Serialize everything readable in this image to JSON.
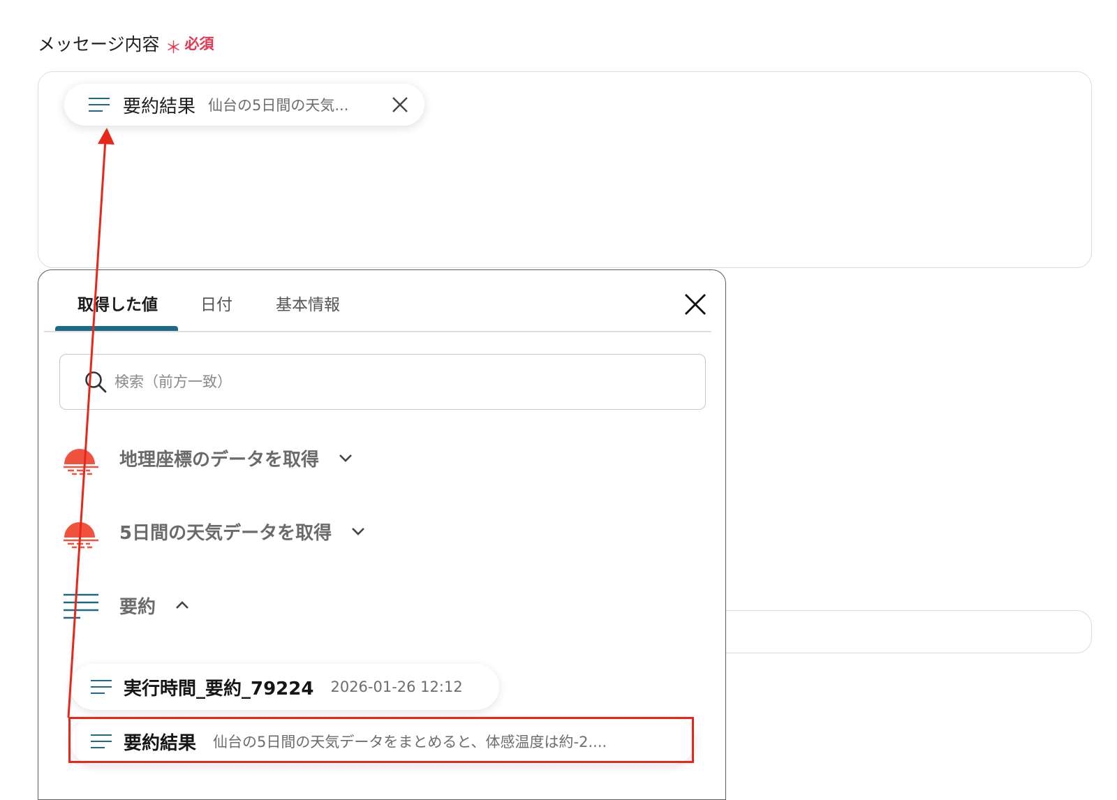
{
  "field": {
    "label": "メッセージ内容",
    "required_mark": "＊",
    "required_text": "必須"
  },
  "chip": {
    "icon": "lines-icon",
    "title": "要約結果",
    "value": "仙台の5日間の天気..."
  },
  "picker": {
    "tabs": [
      {
        "label": "取得した値",
        "active": true
      },
      {
        "label": "日付",
        "active": false
      },
      {
        "label": "基本情報",
        "active": false
      }
    ],
    "search_placeholder": "検索（前方一致）",
    "groups": [
      {
        "icon": "weather-sun-icon",
        "label": "地理座標のデータを取得",
        "expanded": false
      },
      {
        "icon": "weather-sun-icon",
        "label": "5日間の天気データを取得",
        "expanded": false
      },
      {
        "icon": "lines-icon",
        "label": "要約",
        "expanded": true
      }
    ],
    "items": [
      {
        "icon": "lines-icon",
        "title": "実行時間_要約_79224",
        "value": "2026-01-26 12:12"
      },
      {
        "icon": "lines-icon",
        "title": "要約結果",
        "value": "仙台の5日間の天気データをまとめると、体感温度は約-2...."
      }
    ]
  },
  "colors": {
    "accent": "#1e6a86",
    "required": "#e8344e",
    "weather_icon": "#ef5340",
    "annotation": "#e8261a"
  }
}
